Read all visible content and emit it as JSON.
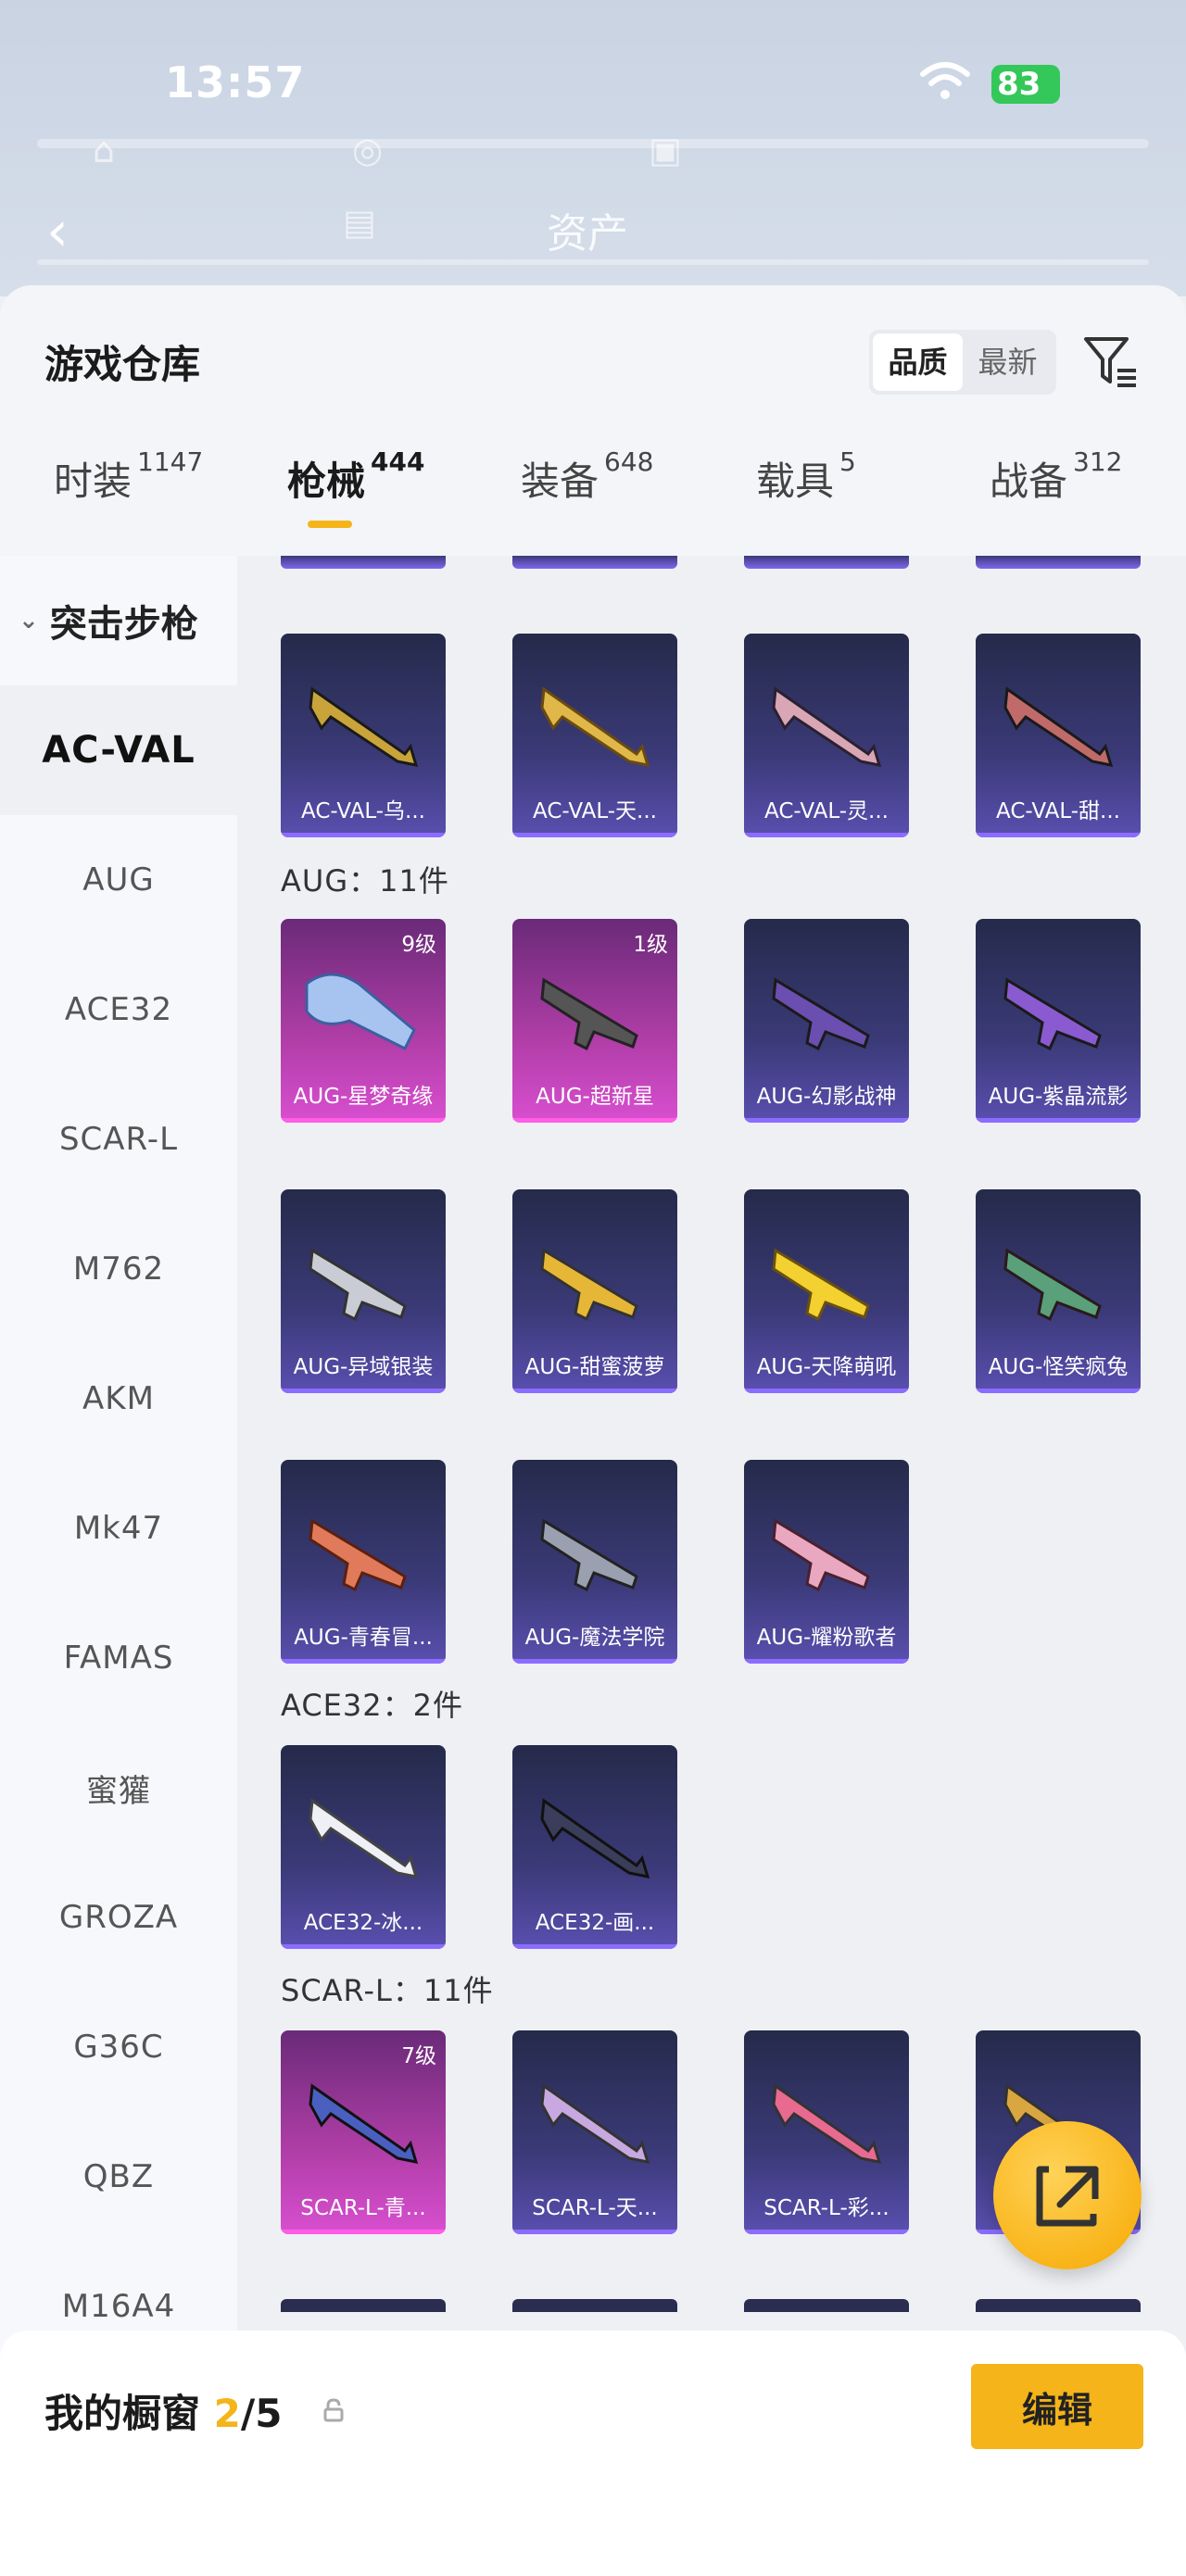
{
  "status": {
    "time": "13:57",
    "battery": "83"
  },
  "header": {
    "back_icon": "back-arrow-icon",
    "tab_label": "资产"
  },
  "warehouse": {
    "title": "游戏仓库",
    "sort": {
      "options": [
        "品质",
        "最新"
      ],
      "selected": "品质"
    },
    "filter_icon": "filter-icon"
  },
  "tabs": [
    {
      "label": "时装",
      "count": "1147"
    },
    {
      "label": "枪械",
      "count": "444",
      "active": true
    },
    {
      "label": "装备",
      "count": "648"
    },
    {
      "label": "载具",
      "count": "5"
    },
    {
      "label": "战备",
      "count": "312"
    }
  ],
  "sidebar": {
    "group": "突击步枪",
    "items": [
      "AC-VAL",
      "AUG",
      "ACE32",
      "SCAR-L",
      "M762",
      "AKM",
      "Mk47",
      "FAMAS",
      "蜜獾",
      "GROZA",
      "G36C",
      "QBZ",
      "M16A4"
    ],
    "active": "AC-VAL"
  },
  "sections": {
    "acval": {
      "items": [
        {
          "name": "AC-VAL-乌...",
          "rarity": "purple"
        },
        {
          "name": "AC-VAL-天...",
          "rarity": "purple"
        },
        {
          "name": "AC-VAL-灵...",
          "rarity": "purple"
        },
        {
          "name": "AC-VAL-甜...",
          "rarity": "purple"
        }
      ]
    },
    "aug": {
      "header": "AUG：11件",
      "items": [
        {
          "name": "AUG-星梦奇缘",
          "level": "9级",
          "rarity": "pink"
        },
        {
          "name": "AUG-超新星",
          "level": "1级",
          "rarity": "pink"
        },
        {
          "name": "AUG-幻影战神",
          "rarity": "purple"
        },
        {
          "name": "AUG-紫晶流影",
          "rarity": "purple"
        },
        {
          "name": "AUG-异域银装",
          "rarity": "purple"
        },
        {
          "name": "AUG-甜蜜菠萝",
          "rarity": "purple"
        },
        {
          "name": "AUG-天降萌吼",
          "rarity": "purple"
        },
        {
          "name": "AUG-怪笑疯兔",
          "rarity": "purple"
        },
        {
          "name": "AUG-青春冒...",
          "rarity": "purple"
        },
        {
          "name": "AUG-魔法学院",
          "rarity": "purple"
        },
        {
          "name": "AUG-耀粉歌者",
          "rarity": "purple"
        }
      ]
    },
    "ace32": {
      "header": "ACE32：2件",
      "items": [
        {
          "name": "ACE32-冰...",
          "rarity": "purple"
        },
        {
          "name": "ACE32-画...",
          "rarity": "purple"
        }
      ]
    },
    "scarl": {
      "header": "SCAR-L：11件",
      "items": [
        {
          "name": "SCAR-L-青...",
          "level": "7级",
          "rarity": "pink"
        },
        {
          "name": "SCAR-L-天...",
          "rarity": "purple"
        },
        {
          "name": "SCAR-L-彩...",
          "rarity": "purple"
        },
        {
          "name": "",
          "rarity": "purple"
        }
      ]
    }
  },
  "fab_icon": "share-external-icon",
  "showcase": {
    "title": "我的橱窗",
    "used": "2",
    "total": "/5",
    "lock_icon": "lock-icon",
    "edit_label": "编辑"
  },
  "colors": {
    "accent": "#f4b41a",
    "purple_card": "#3b3a78",
    "pink_card": "#b13ea8"
  }
}
